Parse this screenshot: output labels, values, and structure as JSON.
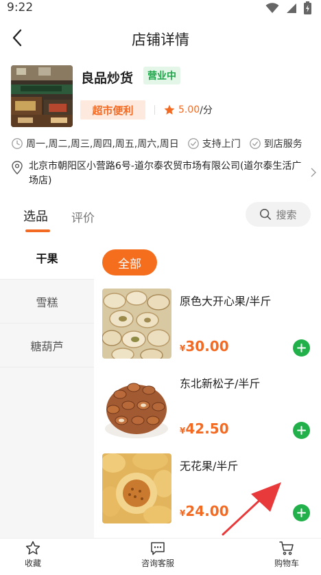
{
  "status_bar": {
    "time": "9:22",
    "icons": [
      "wifi-icon",
      "signal-icon",
      "battery-icon"
    ]
  },
  "nav": {
    "title": "店铺详情",
    "back_icon": "chevron-left-icon"
  },
  "store": {
    "name": "良品炒货",
    "status_badge": "营业中",
    "category": "超市便利",
    "rating_score": "5.00",
    "rating_unit": "/分",
    "hours": "周一,周二,周三,周四,周五,周六,周日",
    "services": [
      "支持上门",
      "到店服务"
    ],
    "address": "北京市朝阳区小营路6号-道尔泰农贸市场有限公司(道尔泰生活广场店)"
  },
  "tabs": {
    "active": "选品",
    "inactive": "评价",
    "search_label": "搜索"
  },
  "sidebar": {
    "items": [
      {
        "label": "干果"
      },
      {
        "label": "雪糕"
      },
      {
        "label": "糖葫芦"
      }
    ]
  },
  "filter": {
    "label": "全部"
  },
  "products": [
    {
      "name": "原色大开心果/半斤",
      "currency": "¥",
      "price": "30.00"
    },
    {
      "name": "东北新松子/半斤",
      "currency": "¥",
      "price": "42.50"
    },
    {
      "name": "无花果/半斤",
      "currency": "¥",
      "price": "24.00"
    }
  ],
  "bottom_bar": {
    "favorite": "收藏",
    "service": "咨询客服",
    "cart": "购物车"
  },
  "colors": {
    "accent": "#f36a22",
    "open_green": "#1fa64a",
    "add_green": "#22b04b",
    "annotation_red": "#e8393b"
  }
}
